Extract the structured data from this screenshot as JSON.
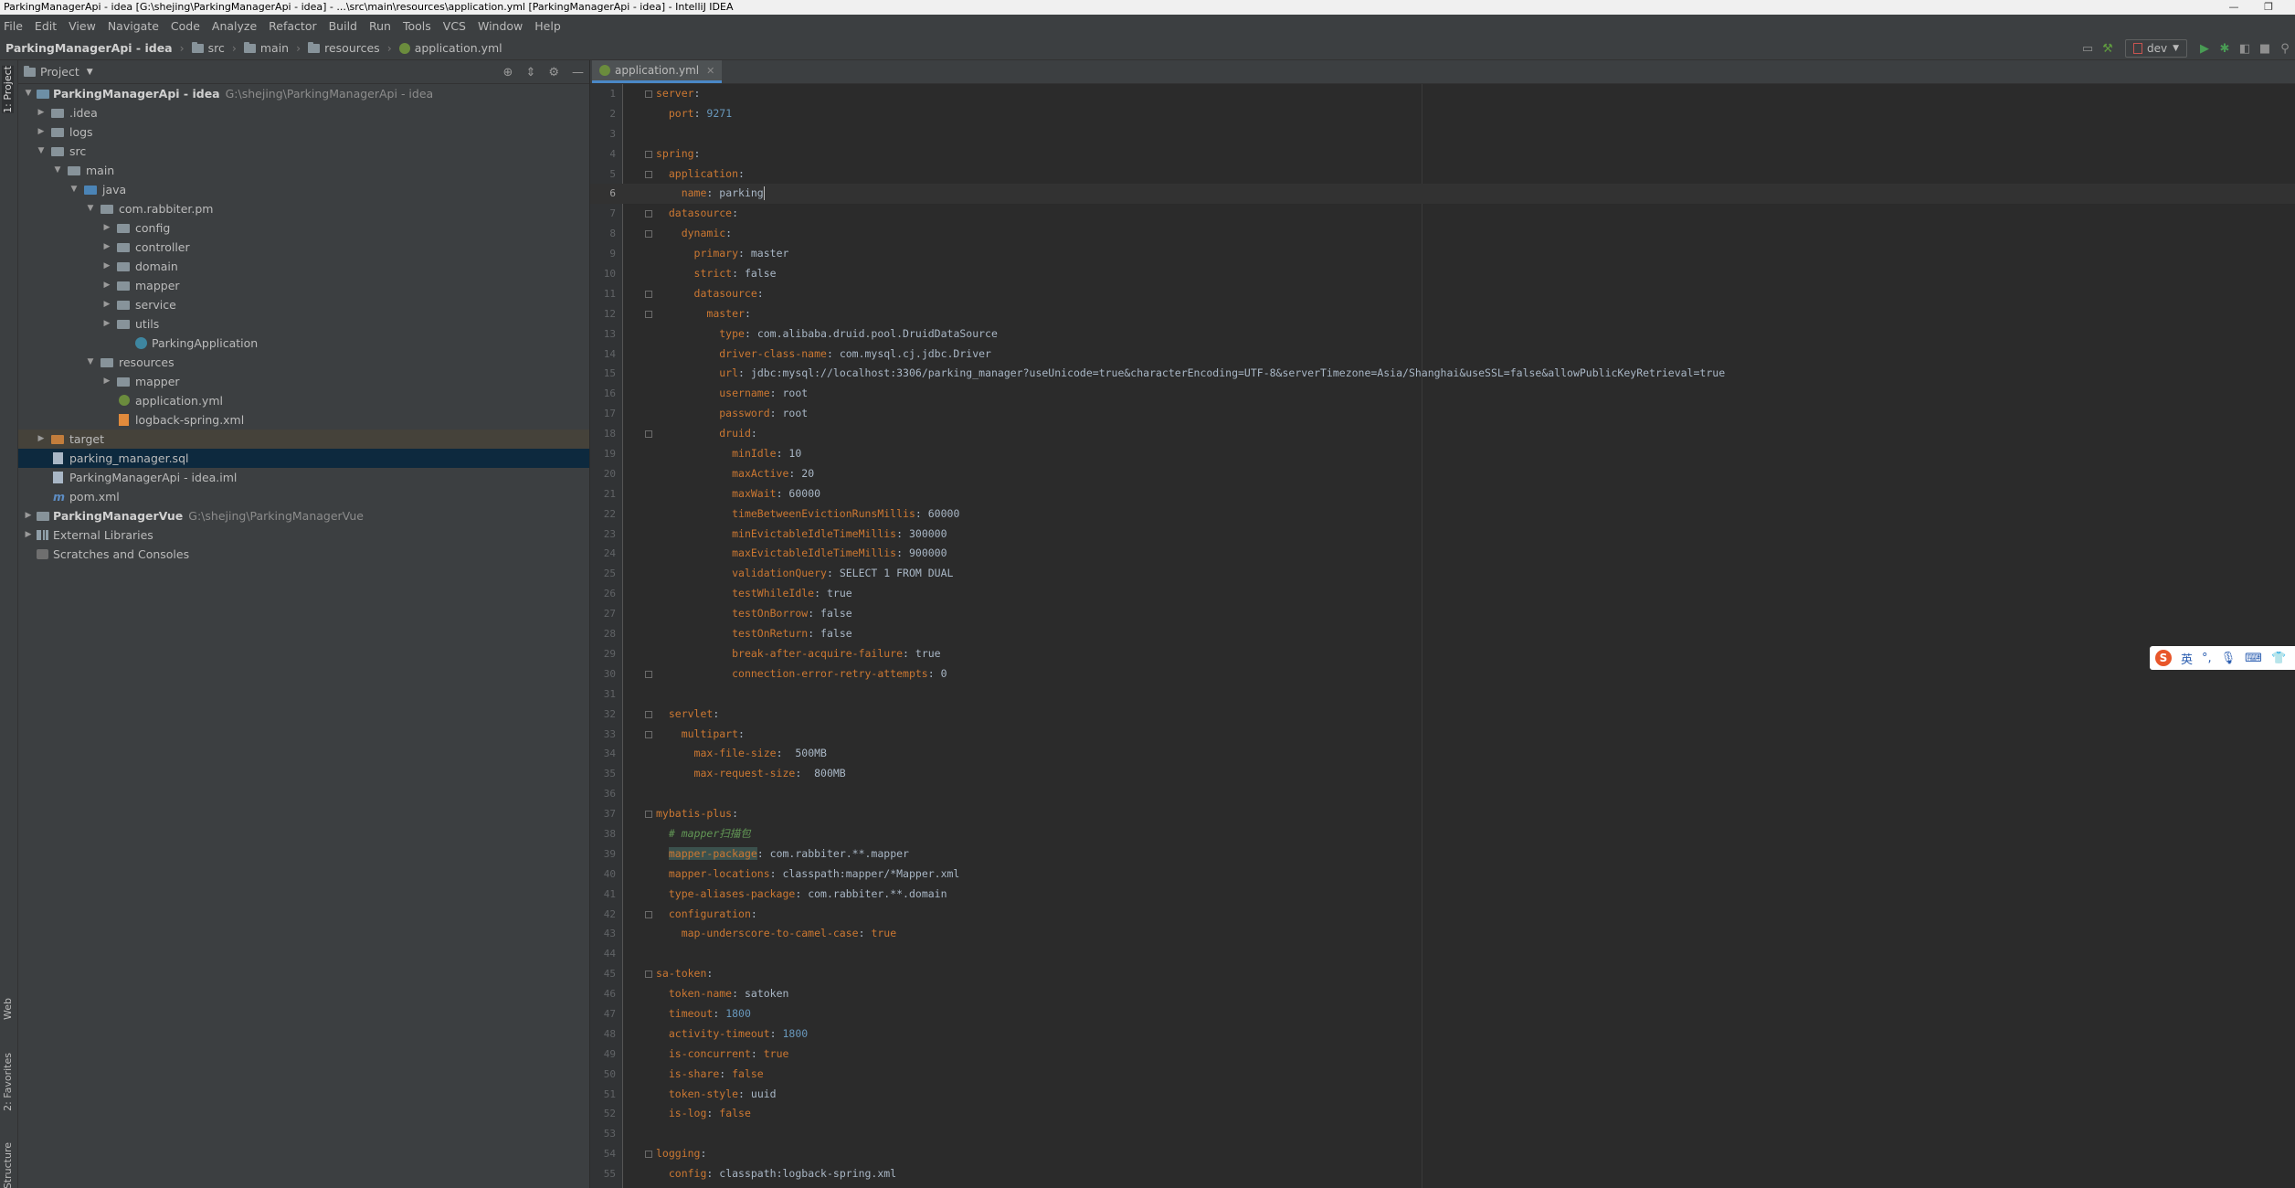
{
  "window": {
    "title": "ParkingManagerApi - idea [G:\\shejing\\ParkingManagerApi - idea] - ...\\src\\main\\resources\\application.yml [ParkingManagerApi - idea] - IntelliJ IDEA"
  },
  "menu": [
    "File",
    "Edit",
    "View",
    "Navigate",
    "Code",
    "Analyze",
    "Refactor",
    "Build",
    "Run",
    "Tools",
    "VCS",
    "Window",
    "Help"
  ],
  "breadcrumb": [
    "ParkingManagerApi - idea",
    "src",
    "main",
    "resources",
    "application.yml"
  ],
  "run_config": "dev",
  "left_strip": {
    "project": "1: Project",
    "web": "Web",
    "favorites": "2: Favorites",
    "structure": "Structure"
  },
  "project_panel": {
    "title": "Project",
    "tree": [
      {
        "label": "ParkingManagerApi - idea",
        "path": "G:\\shejing\\ParkingManagerApi - idea"
      },
      {
        "label": ".idea"
      },
      {
        "label": "logs"
      },
      {
        "label": "src"
      },
      {
        "label": "main"
      },
      {
        "label": "java"
      },
      {
        "label": "com.rabbiter.pm"
      },
      {
        "label": "config"
      },
      {
        "label": "controller"
      },
      {
        "label": "domain"
      },
      {
        "label": "mapper"
      },
      {
        "label": "service"
      },
      {
        "label": "utils"
      },
      {
        "label": "ParkingApplication"
      },
      {
        "label": "resources"
      },
      {
        "label": "mapper"
      },
      {
        "label": "application.yml"
      },
      {
        "label": "logback-spring.xml"
      },
      {
        "label": "target"
      },
      {
        "label": "parking_manager.sql"
      },
      {
        "label": "ParkingManagerApi - idea.iml"
      },
      {
        "label": "pom.xml"
      },
      {
        "label": "ParkingManagerVue",
        "path": "G:\\shejing\\ParkingManagerVue"
      },
      {
        "label": "External Libraries"
      },
      {
        "label": "Scratches and Consoles"
      }
    ]
  },
  "editor": {
    "tab": "application.yml",
    "lines": [
      {
        "n": "1",
        "i": "",
        "k": "server",
        "s": ":",
        "v": ""
      },
      {
        "n": "2",
        "i": "  ",
        "k": "port",
        "s": ": ",
        "v": "9271"
      },
      {
        "n": "3",
        "i": "",
        "k": "",
        "s": "",
        "v": ""
      },
      {
        "n": "4",
        "i": "",
        "k": "spring",
        "s": ":",
        "v": ""
      },
      {
        "n": "5",
        "i": "  ",
        "k": "application",
        "s": ":",
        "v": ""
      },
      {
        "n": "6",
        "i": "    ",
        "k": "name",
        "s": ": ",
        "v": "parking"
      },
      {
        "n": "7",
        "i": "  ",
        "k": "datasource",
        "s": ":",
        "v": ""
      },
      {
        "n": "8",
        "i": "    ",
        "k": "dynamic",
        "s": ":",
        "v": ""
      },
      {
        "n": "9",
        "i": "      ",
        "k": "primary",
        "s": ": ",
        "v": "master"
      },
      {
        "n": "10",
        "i": "      ",
        "k": "strict",
        "s": ": ",
        "v": "false"
      },
      {
        "n": "11",
        "i": "      ",
        "k": "datasource",
        "s": ":",
        "v": ""
      },
      {
        "n": "12",
        "i": "        ",
        "k": "master",
        "s": ":",
        "v": ""
      },
      {
        "n": "13",
        "i": "          ",
        "k": "type",
        "s": ": ",
        "v": "com.alibaba.druid.pool.DruidDataSource"
      },
      {
        "n": "14",
        "i": "          ",
        "k": "driver-class-name",
        "s": ": ",
        "v": "com.mysql.cj.jdbc.Driver"
      },
      {
        "n": "15",
        "i": "          ",
        "k": "url",
        "s": ": ",
        "v": "jdbc:mysql://localhost:3306/parking_manager?useUnicode=true&characterEncoding=UTF-8&serverTimezone=Asia/Shanghai&useSSL=false&allowPublicKeyRetrieval=true"
      },
      {
        "n": "16",
        "i": "          ",
        "k": "username",
        "s": ": ",
        "v": "root"
      },
      {
        "n": "17",
        "i": "          ",
        "k": "password",
        "s": ": ",
        "v": "root"
      },
      {
        "n": "18",
        "i": "          ",
        "k": "druid",
        "s": ":",
        "v": ""
      },
      {
        "n": "19",
        "i": "            ",
        "k": "minIdle",
        "s": ": ",
        "v": "10"
      },
      {
        "n": "20",
        "i": "            ",
        "k": "maxActive",
        "s": ": ",
        "v": "20"
      },
      {
        "n": "21",
        "i": "            ",
        "k": "maxWait",
        "s": ": ",
        "v": "60000"
      },
      {
        "n": "22",
        "i": "            ",
        "k": "timeBetweenEvictionRunsMillis",
        "s": ": ",
        "v": "60000"
      },
      {
        "n": "23",
        "i": "            ",
        "k": "minEvictableIdleTimeMillis",
        "s": ": ",
        "v": "300000"
      },
      {
        "n": "24",
        "i": "            ",
        "k": "maxEvictableIdleTimeMillis",
        "s": ": ",
        "v": "900000"
      },
      {
        "n": "25",
        "i": "            ",
        "k": "validationQuery",
        "s": ": ",
        "v": "SELECT 1 FROM DUAL"
      },
      {
        "n": "26",
        "i": "            ",
        "k": "testWhileIdle",
        "s": ": ",
        "v": "true"
      },
      {
        "n": "27",
        "i": "            ",
        "k": "testOnBorrow",
        "s": ": ",
        "v": "false"
      },
      {
        "n": "28",
        "i": "            ",
        "k": "testOnReturn",
        "s": ": ",
        "v": "false"
      },
      {
        "n": "29",
        "i": "            ",
        "k": "break-after-acquire-failure",
        "s": ": ",
        "v": "true"
      },
      {
        "n": "30",
        "i": "            ",
        "k": "connection-error-retry-attempts",
        "s": ": ",
        "v": "0"
      },
      {
        "n": "31",
        "i": "",
        "k": "",
        "s": "",
        "v": ""
      },
      {
        "n": "32",
        "i": "  ",
        "k": "servlet",
        "s": ":",
        "v": ""
      },
      {
        "n": "33",
        "i": "    ",
        "k": "multipart",
        "s": ":",
        "v": ""
      },
      {
        "n": "34",
        "i": "      ",
        "k": "max-file-size",
        "s": ":  ",
        "v": "500MB"
      },
      {
        "n": "35",
        "i": "      ",
        "k": "max-request-size",
        "s": ":  ",
        "v": "800MB"
      },
      {
        "n": "36",
        "i": "",
        "k": "",
        "s": "",
        "v": ""
      },
      {
        "n": "37",
        "i": "",
        "k": "mybatis-plus",
        "s": ":",
        "v": ""
      },
      {
        "n": "38",
        "i": "  ",
        "k": "",
        "s": "",
        "v": "",
        "c": "# mapper扫描包"
      },
      {
        "n": "39",
        "i": "  ",
        "k": "mapper-package",
        "s": ": ",
        "v": "com.rabbiter.**.mapper"
      },
      {
        "n": "40",
        "i": "  ",
        "k": "mapper-locations",
        "s": ": ",
        "v": "classpath:mapper/*Mapper.xml"
      },
      {
        "n": "41",
        "i": "  ",
        "k": "type-aliases-package",
        "s": ": ",
        "v": "com.rabbiter.**.domain"
      },
      {
        "n": "42",
        "i": "  ",
        "k": "configuration",
        "s": ":",
        "v": ""
      },
      {
        "n": "43",
        "i": "    ",
        "k": "map-underscore-to-camel-case",
        "s": ": ",
        "v": "true"
      },
      {
        "n": "44",
        "i": "",
        "k": "",
        "s": "",
        "v": ""
      },
      {
        "n": "45",
        "i": "",
        "k": "sa-token",
        "s": ":",
        "v": ""
      },
      {
        "n": "46",
        "i": "  ",
        "k": "token-name",
        "s": ": ",
        "v": "satoken"
      },
      {
        "n": "47",
        "i": "  ",
        "k": "timeout",
        "s": ": ",
        "v": "1800"
      },
      {
        "n": "48",
        "i": "  ",
        "k": "activity-timeout",
        "s": ": ",
        "v": "1800"
      },
      {
        "n": "49",
        "i": "  ",
        "k": "is-concurrent",
        "s": ": ",
        "v": "true"
      },
      {
        "n": "50",
        "i": "  ",
        "k": "is-share",
        "s": ": ",
        "v": "false"
      },
      {
        "n": "51",
        "i": "  ",
        "k": "token-style",
        "s": ": ",
        "v": "uuid"
      },
      {
        "n": "52",
        "i": "  ",
        "k": "is-log",
        "s": ": ",
        "v": "false"
      },
      {
        "n": "53",
        "i": "",
        "k": "",
        "s": "",
        "v": ""
      },
      {
        "n": "54",
        "i": "",
        "k": "logging",
        "s": ":",
        "v": ""
      },
      {
        "n": "55",
        "i": "  ",
        "k": "config",
        "s": ": ",
        "v": "classpath:logback-spring.xml"
      }
    ]
  },
  "ime": {
    "lang": "英"
  }
}
